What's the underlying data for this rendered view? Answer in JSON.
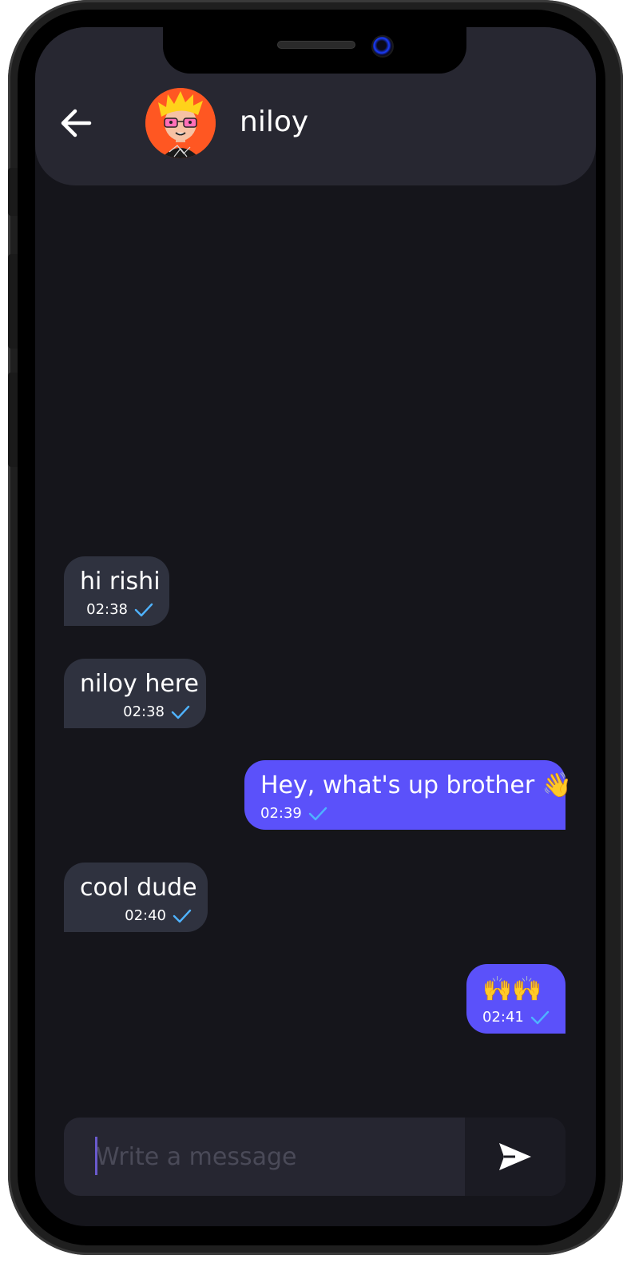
{
  "header": {
    "contact_name": "niloy",
    "back_icon": "arrow-left-icon",
    "avatar": "cartoon-avatar-glasses"
  },
  "colors": {
    "screen_bg": "#15151b",
    "header_bg": "#272731",
    "incoming_bubble": "#2f323f",
    "outgoing_bubble": "#5b51fa",
    "check_color": "#4fb3ff",
    "avatar_bg": "#ff5722"
  },
  "messages": [
    {
      "direction": "in",
      "text": "hi rishi",
      "time": "02:38",
      "status_icon": "check-icon"
    },
    {
      "direction": "in",
      "text": "niloy here",
      "time": "02:38",
      "status_icon": "check-icon"
    },
    {
      "direction": "out",
      "text": "Hey, what's up brother 👋",
      "time": "02:39",
      "status_icon": "check-icon"
    },
    {
      "direction": "in",
      "text": "cool dude",
      "time": "02:40",
      "status_icon": "check-icon"
    },
    {
      "direction": "out",
      "text": "🙌🙌",
      "time": "02:41",
      "status_icon": "check-icon"
    }
  ],
  "composer": {
    "placeholder": "Write a message",
    "value": "",
    "send_icon": "send-icon"
  }
}
